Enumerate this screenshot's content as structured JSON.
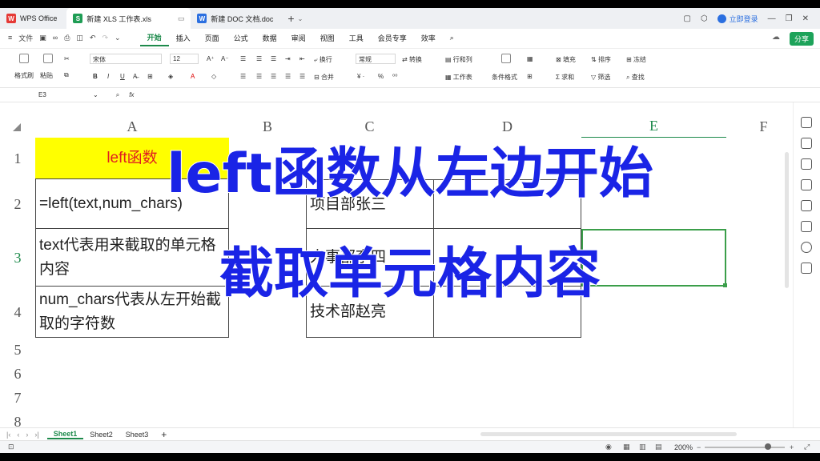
{
  "titlebar": {
    "tabs": [
      {
        "label": "WPS Office",
        "icon": "wps-logo-icon"
      },
      {
        "label": "新建 XLS 工作表.xls",
        "icon": "spreadsheet-icon"
      },
      {
        "label": "新建 DOC 文档.doc",
        "icon": "document-icon"
      }
    ],
    "login_label": "立即登录"
  },
  "menubar": {
    "file_label": "文件",
    "tabs": [
      "开始",
      "插入",
      "页面",
      "公式",
      "数据",
      "审阅",
      "视图",
      "工具",
      "会员专享",
      "效率"
    ],
    "active_tab": "开始",
    "share_label": "分享"
  },
  "ribbon": {
    "format_painter": "格式刷",
    "paste": "粘贴",
    "font_name": "宋体",
    "font_size": "12",
    "wrap": "换行",
    "merge": "合并",
    "number_format": "常规",
    "convert": "转换",
    "row_col": "行和列",
    "worksheet": "工作表",
    "cond_format": "条件格式",
    "fill": "填充",
    "sort": "排序",
    "freeze": "冻结",
    "sum": "求和",
    "filter": "筛选",
    "find": "查找"
  },
  "formulabar": {
    "cell_ref": "E3",
    "fx": "fx"
  },
  "grid": {
    "columns": [
      "A",
      "B",
      "C",
      "D",
      "E",
      "F"
    ],
    "selected_column": "E",
    "rows": [
      "1",
      "2",
      "3",
      "4",
      "5",
      "6",
      "7",
      "8"
    ],
    "selected_row": "3",
    "cells": {
      "A1": "left函数",
      "A2": "=left(text,num_chars)",
      "A3": "text代表用来截取的单元格内容",
      "A4": "num_chars代表从左开始截取的字符数",
      "C2": "项目部张三",
      "C3": "人事部李四",
      "C4": "技术部赵亮"
    },
    "highlight_color": "#ffff00",
    "header_text_color": "#e02020"
  },
  "overlay": {
    "line1": "left函数从左边开始",
    "line2": "截取单元格内容",
    "color": "#1a24e6"
  },
  "sheets": {
    "tabs": [
      "Sheet1",
      "Sheet2",
      "Sheet3"
    ],
    "active": "Sheet1"
  },
  "status": {
    "zoom": "200%"
  }
}
